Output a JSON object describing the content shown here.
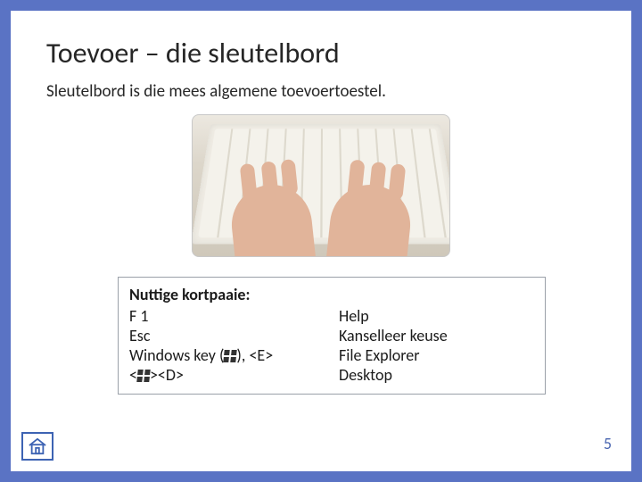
{
  "title": "Toevoer – die sleutelbord",
  "subtitle": "Sleutelbord is die mees algemene toevoertoestel.",
  "image_alt": "Hande wat op 'n sleutelbord tik",
  "shortcuts": {
    "heading": "Nuttige kortpaaie:",
    "rows": [
      {
        "key": "F 1",
        "desc": "Help"
      },
      {
        "key": "Esc",
        "desc": "Kanselleer keuse"
      },
      {
        "key": "Windows key (⊞), <E>",
        "desc": "File Explorer"
      },
      {
        "key": "<⊞><D>",
        "desc": "Desktop"
      }
    ]
  },
  "page_number": "5"
}
